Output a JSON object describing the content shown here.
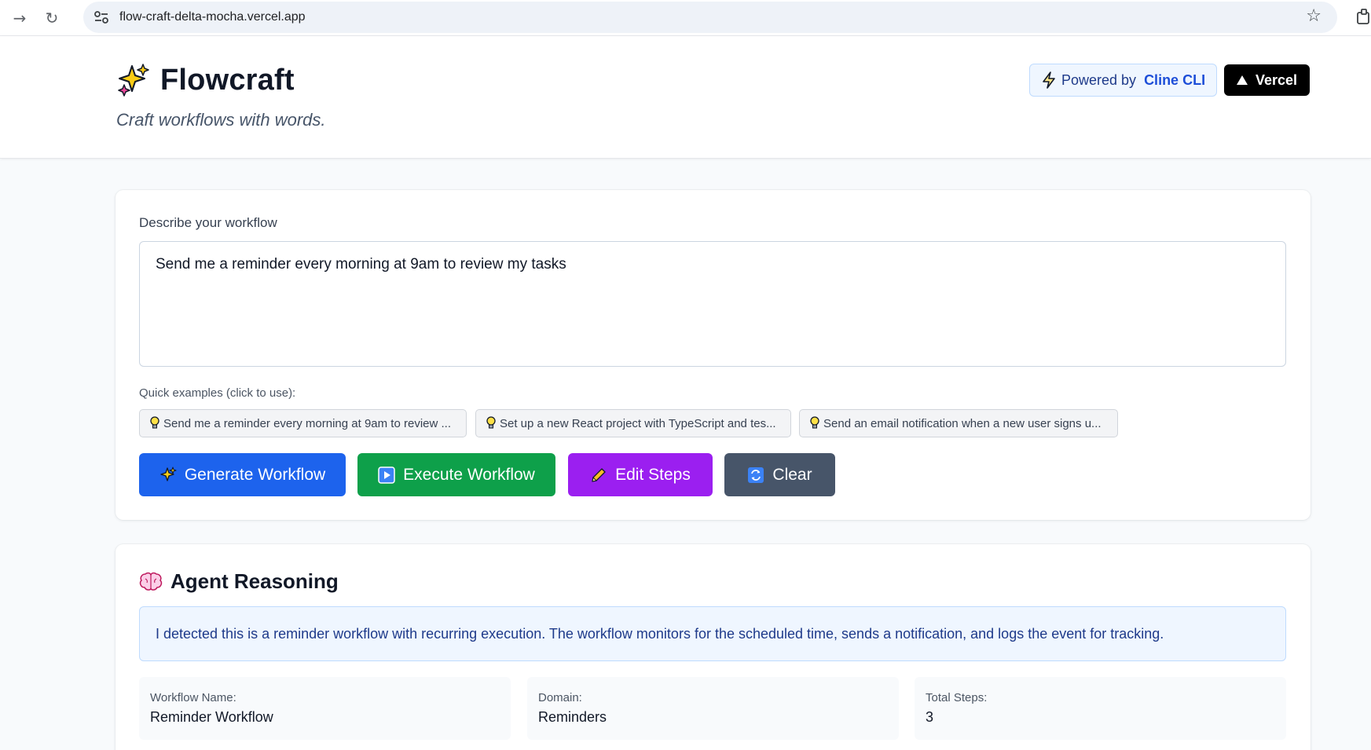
{
  "browser": {
    "url": "flow-craft-delta-mocha.vercel.app",
    "icons": [
      "forward-icon",
      "reload-icon",
      "site-settings-icon",
      "bookmark-star-icon",
      "extensions-icon"
    ]
  },
  "header": {
    "title": "Flowcraft",
    "tagline": "Craft workflows with words.",
    "powered_by_label": "Powered by",
    "powered_by_name": "Cline CLI",
    "vercel_label": "Vercel"
  },
  "input_card": {
    "label": "Describe your workflow",
    "textarea_value": "Send me a reminder every morning at 9am to review my tasks",
    "examples_label": "Quick examples (click to use):",
    "examples": [
      "Send me a reminder every morning at 9am to review ...",
      "Set up a new React project with TypeScript and tes...",
      "Send an email notification when a new user signs u..."
    ],
    "buttons": {
      "generate": "Generate Workflow",
      "execute": "Execute Workflow",
      "edit": "Edit Steps",
      "clear": "Clear"
    }
  },
  "reasoning": {
    "title": "Agent Reasoning",
    "text": "I detected this is a reminder workflow with recurring execution. The workflow monitors for the scheduled time, sends a notification, and logs the event for tracking.",
    "stats": [
      {
        "label": "Workflow Name:",
        "value": "Reminder Workflow"
      },
      {
        "label": "Domain:",
        "value": "Reminders"
      },
      {
        "label": "Total Steps:",
        "value": "3"
      }
    ]
  },
  "colors": {
    "generate": "#1d63ed",
    "execute": "#0ea04a",
    "edit": "#9b1ff0",
    "clear": "#475569",
    "accent": "#1d4ed8"
  }
}
